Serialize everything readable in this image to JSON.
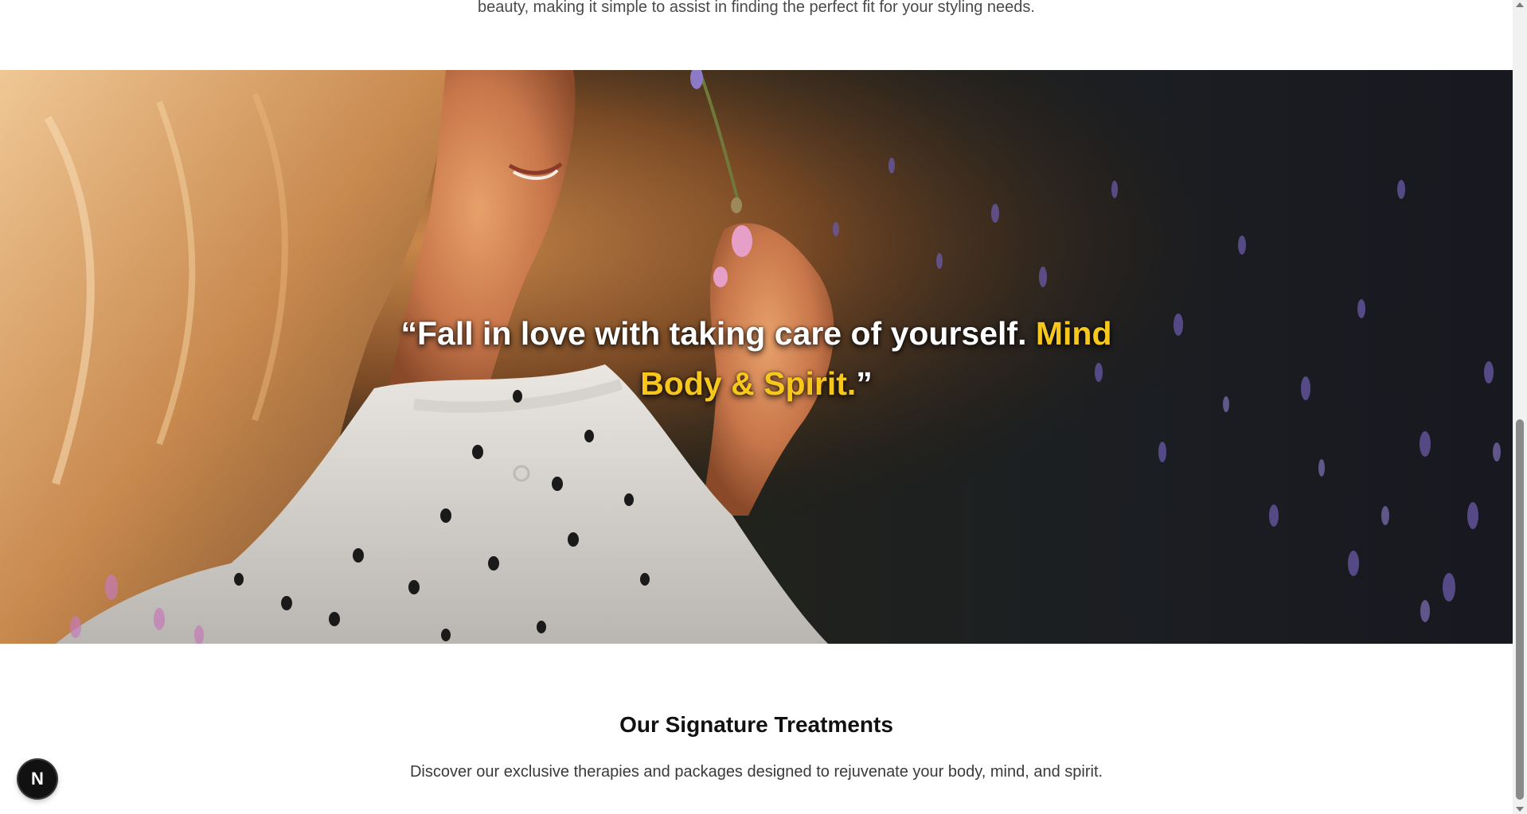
{
  "intro": {
    "text": "beauty, making it simple to assist in finding the perfect fit for your styling needs."
  },
  "hero": {
    "quote_line1_white": "“Fall in love with taking care of yourself. ",
    "quote_line1_accent": "Mind",
    "quote_line2_accent": "Body & Spirit.",
    "quote_line2_white": "”",
    "accent_color": "#f7c71c"
  },
  "treatments": {
    "title": "Our Signature Treatments",
    "subtitle": "Discover our exclusive therapies and packages designed to rejuvenate your body, mind, and spirit."
  },
  "badge": {
    "label": "N"
  }
}
